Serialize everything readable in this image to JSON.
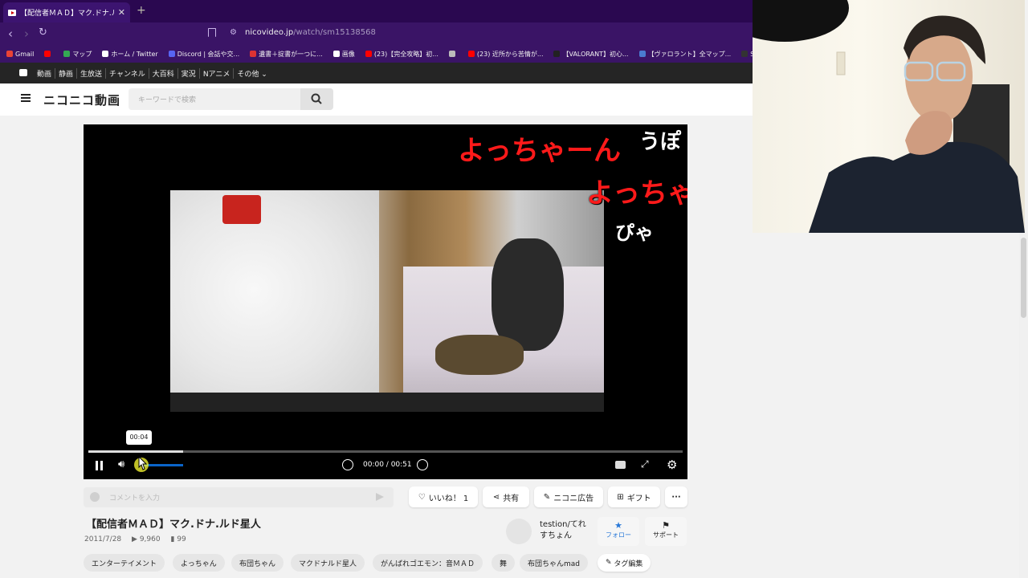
{
  "browser": {
    "tab_title": "【配信者ＭＡＤ】マク.ドナ.ルド星人",
    "new_tab": "+",
    "close": "✕",
    "url_host": "nicovideo.jp",
    "url_path": "/watch/sm15138568",
    "bookmarks": [
      {
        "label": "Gmail",
        "color": "#ea4335"
      },
      {
        "label": "",
        "color": "#ff0000"
      },
      {
        "label": "マップ",
        "color": "#34a853"
      },
      {
        "label": "ホーム / Twitter",
        "color": "#ffffff"
      },
      {
        "label": "Discord | 会話や交...",
        "color": "#5865f2"
      },
      {
        "label": "遺書＋掟書が一つに...",
        "color": "#d33"
      },
      {
        "label": "画像",
        "color": "#ffffff"
      },
      {
        "label": "(23)【完全攻略】初...",
        "color": "#ff0000"
      },
      {
        "label": "",
        "color": "#bbbbbb"
      },
      {
        "label": "(23) 近所から苦情が...",
        "color": "#ff0000"
      },
      {
        "label": "【VALORANT】初心...",
        "color": "#222222"
      },
      {
        "label": "【ヴァロラント】全マップ...",
        "color": "#4a7bd0"
      },
      {
        "label": "SteamDB",
        "color": "#333333"
      }
    ]
  },
  "nico_nav": [
    "動画",
    "静画",
    "生放送",
    "チャンネル",
    "大百科",
    "実況",
    "Nアニメ",
    "その他 ⌄"
  ],
  "site": {
    "logo": "ニコニコ動画",
    "search_placeholder": "キーワードで検索"
  },
  "player": {
    "comments": [
      {
        "text": "よっちゃーん",
        "color": "#ff1a1a"
      },
      {
        "text": "うぽ",
        "color": "#ffffff"
      },
      {
        "text": "よっちゃ",
        "color": "#ff1a1a"
      },
      {
        "text": "ぴゃ",
        "color": "#ffffff"
      }
    ],
    "tooltip_time": "00:04",
    "timecode": "00:00 / 00:51",
    "progress": 0.16
  },
  "actions": {
    "comment_placeholder": "コメントを入力",
    "like": "いいね！ 1",
    "share": "共有",
    "ad": "ニコニ広告",
    "gift": "ギフト",
    "more": "···"
  },
  "video": {
    "title": "【配信者ＭＡＤ】マク.ドナ.ルド星人",
    "date": "2011/7/28",
    "views": "9,960",
    "comments": "99"
  },
  "uploader": {
    "name_line1": "testion/てれ",
    "name_line2": "すちょん",
    "follow": "フォロー",
    "support": "サポート"
  },
  "tags": [
    "エンターテイメント",
    "よっちゃん",
    "布団ちゃん",
    "マクドナルド星人",
    "がんばれゴエモン：音ＭＡＤ",
    "舞",
    "布団ちゃんmad"
  ],
  "tag_edit": "タグ編集"
}
